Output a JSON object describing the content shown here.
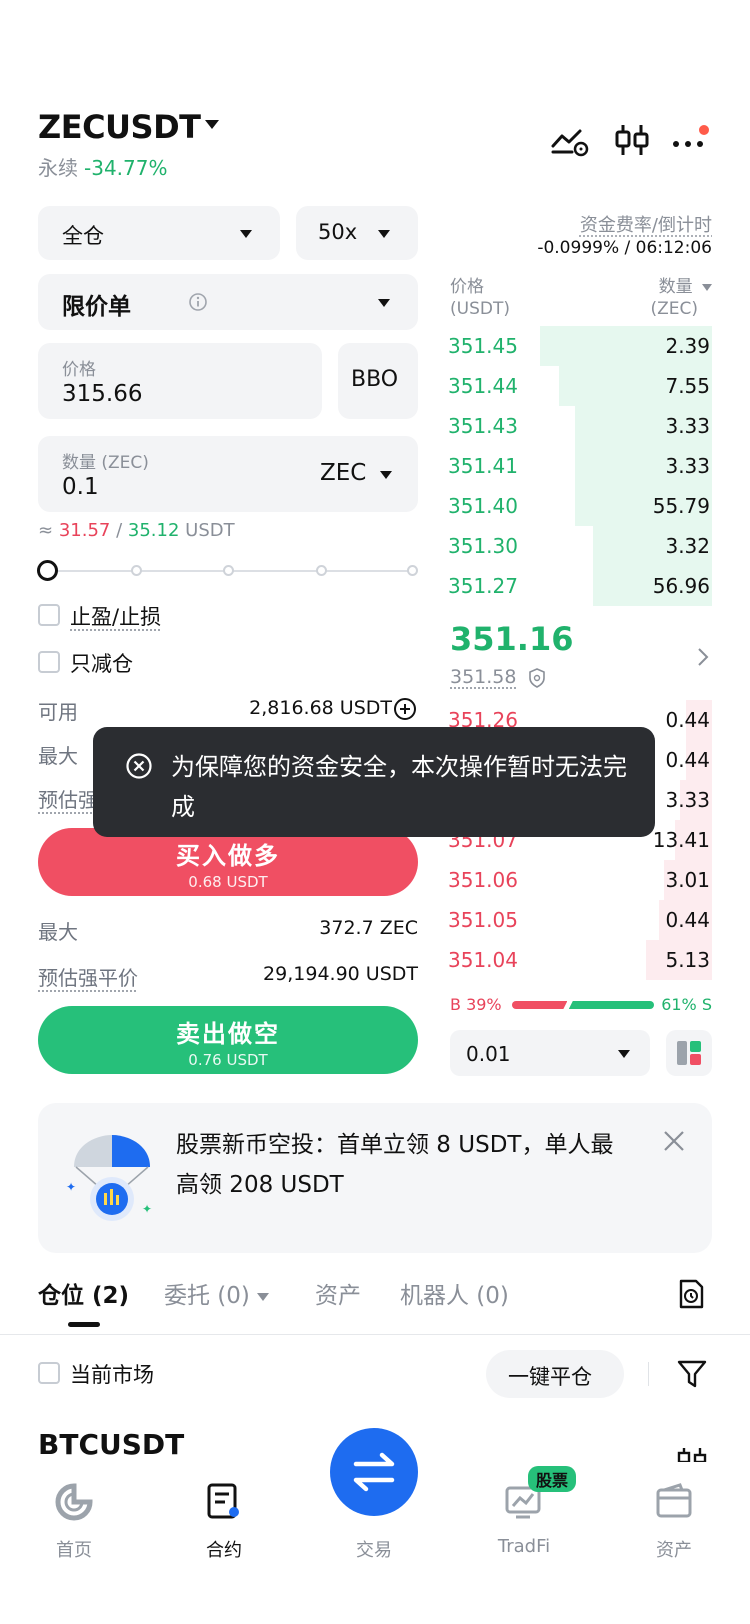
{
  "header": {
    "pair": "ZECUSDT",
    "type": "永续",
    "change": "-34.77%"
  },
  "order_form": {
    "margin_mode": "全仓",
    "leverage": "50x",
    "order_type": "限价单",
    "price_label": "价格",
    "price_value": "315.66",
    "bbo_label": "BBO",
    "qty_label": "数量 (ZEC)",
    "qty_value": "0.1",
    "qty_unit": "ZEC",
    "approx_prefix": "≈",
    "approx_buy": "31.57",
    "approx_sep": "/",
    "approx_sell": "35.12",
    "approx_unit": "USDT",
    "tpsl_label": "止盈/止损",
    "reduce_only_label": "只减仓",
    "available_label": "可用",
    "available_value": "2,816.68 USDT",
    "max_label": "最大",
    "est_liq_label": "预估强",
    "buy_label": "买入做多",
    "buy_sub": "0.68 USDT",
    "max_label_2": "最大",
    "max_value_2": "372.7 ZEC",
    "est_liq_label_2": "预估强平价",
    "est_liq_value_2": "29,194.90 USDT",
    "sell_label": "卖出做空",
    "sell_sub": "0.76 USDT"
  },
  "funding": {
    "label": "资金费率/倒计时",
    "value": "-0.0999% / 06:12:06"
  },
  "orderbook": {
    "price_head": "价格",
    "price_unit": "(USDT)",
    "qty_head": "数量",
    "qty_unit": "(ZEC)",
    "asks": [
      {
        "price": "351.45",
        "qty": "2.39",
        "depth": 0.65
      },
      {
        "price": "351.44",
        "qty": "7.55",
        "depth": 0.58
      },
      {
        "price": "351.43",
        "qty": "3.33",
        "depth": 0.52
      },
      {
        "price": "351.41",
        "qty": "3.33",
        "depth": 0.52
      },
      {
        "price": "351.40",
        "qty": "55.79",
        "depth": 0.52
      },
      {
        "price": "351.30",
        "qty": "3.32",
        "depth": 0.45
      },
      {
        "price": "351.27",
        "qty": "56.96",
        "depth": 0.45
      }
    ],
    "last_price": "351.16",
    "mark_price": "351.58",
    "bids": [
      {
        "price": "351.26",
        "qty": "0.44",
        "depth": 0.1
      },
      {
        "price": "",
        "qty": "0.44",
        "depth": 0.1
      },
      {
        "price": "",
        "qty": "3.33",
        "depth": 0.12
      },
      {
        "price": "351.07",
        "qty": "13.41",
        "depth": 0.14
      },
      {
        "price": "351.06",
        "qty": "3.01",
        "depth": 0.18
      },
      {
        "price": "351.05",
        "qty": "0.44",
        "depth": 0.2
      },
      {
        "price": "351.04",
        "qty": "5.13",
        "depth": 0.25
      }
    ],
    "ratio_buy": "B 39%",
    "ratio_sell": "61% S",
    "ratio_buy_value": 0.39,
    "precision": "0.01"
  },
  "toast": {
    "message": "为保障您的资金安全，本次操作暂时无法完成"
  },
  "promo": {
    "text": "股票新币空投：首单立领 8 USDT，单人最高领 208 USDT"
  },
  "tabs": [
    {
      "label": "仓位 (2)"
    },
    {
      "label": "委托 (0)"
    },
    {
      "label": "资产"
    },
    {
      "label": "机器人 (0)"
    }
  ],
  "filter": {
    "current_market_label": "当前市场",
    "close_all_label": "一键平仓"
  },
  "position": {
    "symbol": "BTCUSDT"
  },
  "nav": {
    "items": [
      {
        "label": "首页"
      },
      {
        "label": "合约"
      },
      {
        "label": "交易"
      },
      {
        "label": "TradFi",
        "badge": "股票"
      },
      {
        "label": "资产"
      }
    ]
  },
  "colors": {
    "green": "#20b26c",
    "red": "#e8435a",
    "blue": "#1e6cf0"
  }
}
